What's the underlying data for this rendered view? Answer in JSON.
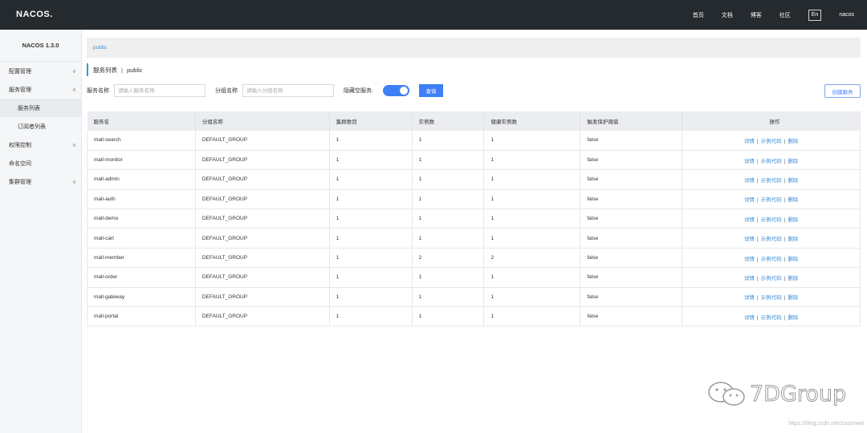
{
  "topbar": {
    "logo": "NACOS.",
    "nav": [
      "首页",
      "文档",
      "博客",
      "社区"
    ],
    "lang": "En",
    "user": "nacos"
  },
  "sidebar": {
    "version": "NACOS 1.3.0",
    "items": [
      {
        "label": "配置管理",
        "chevron": "∨"
      },
      {
        "label": "服务管理",
        "chevron": "∧"
      },
      {
        "label": "服务列表"
      },
      {
        "label": "订阅者列表"
      },
      {
        "label": "权限控制",
        "chevron": "∨"
      },
      {
        "label": "命名空间"
      },
      {
        "label": "集群管理",
        "chevron": "∨"
      }
    ]
  },
  "namespace": {
    "active": "public"
  },
  "page": {
    "title": "服务列表",
    "sep": "|",
    "namespace": "public"
  },
  "filters": {
    "service_label": "服务名称",
    "service_placeholder": "请输入服务名称",
    "group_label": "分组名称",
    "group_placeholder": "请输入分组名称",
    "hide_empty_label": "隐藏空服务:",
    "hide_empty_on": true,
    "query_label": "查询",
    "create_label": "创建服务"
  },
  "table": {
    "headers": [
      "服务名",
      "分组名称",
      "集群数目",
      "实例数",
      "健康实例数",
      "触发保护阈值",
      "操作"
    ],
    "ops": {
      "detail": "详情",
      "sample": "示例代码",
      "delete": "删除",
      "sep": "|"
    },
    "rows": [
      {
        "name": "mall-search",
        "group": "DEFAULT_GROUP",
        "clusters": "1",
        "instances": "1",
        "healthy": "1",
        "threshold": "false"
      },
      {
        "name": "mall-monitor",
        "group": "DEFAULT_GROUP",
        "clusters": "1",
        "instances": "1",
        "healthy": "1",
        "threshold": "false"
      },
      {
        "name": "mall-admin",
        "group": "DEFAULT_GROUP",
        "clusters": "1",
        "instances": "1",
        "healthy": "1",
        "threshold": "false"
      },
      {
        "name": "mall-auth",
        "group": "DEFAULT_GROUP",
        "clusters": "1",
        "instances": "1",
        "healthy": "1",
        "threshold": "false"
      },
      {
        "name": "mall-demo",
        "group": "DEFAULT_GROUP",
        "clusters": "1",
        "instances": "1",
        "healthy": "1",
        "threshold": "false"
      },
      {
        "name": "mall-cart",
        "group": "DEFAULT_GROUP",
        "clusters": "1",
        "instances": "1",
        "healthy": "1",
        "threshold": "false"
      },
      {
        "name": "mall-member",
        "group": "DEFAULT_GROUP",
        "clusters": "1",
        "instances": "2",
        "healthy": "2",
        "threshold": "false"
      },
      {
        "name": "mall-order",
        "group": "DEFAULT_GROUP",
        "clusters": "1",
        "instances": "1",
        "healthy": "1",
        "threshold": "false"
      },
      {
        "name": "mall-gateway",
        "group": "DEFAULT_GROUP",
        "clusters": "1",
        "instances": "1",
        "healthy": "1",
        "threshold": "false"
      },
      {
        "name": "mall-portal",
        "group": "DEFAULT_GROUP",
        "clusters": "1",
        "instances": "1",
        "healthy": "1",
        "threshold": "false"
      }
    ]
  },
  "watermark": {
    "text": "7DGroup",
    "url": "https://blog.csdn.net/zuozewei"
  },
  "colors": {
    "accent": "#3f7ff5",
    "link": "#3b8ed8",
    "topbar": "#252a2f"
  }
}
